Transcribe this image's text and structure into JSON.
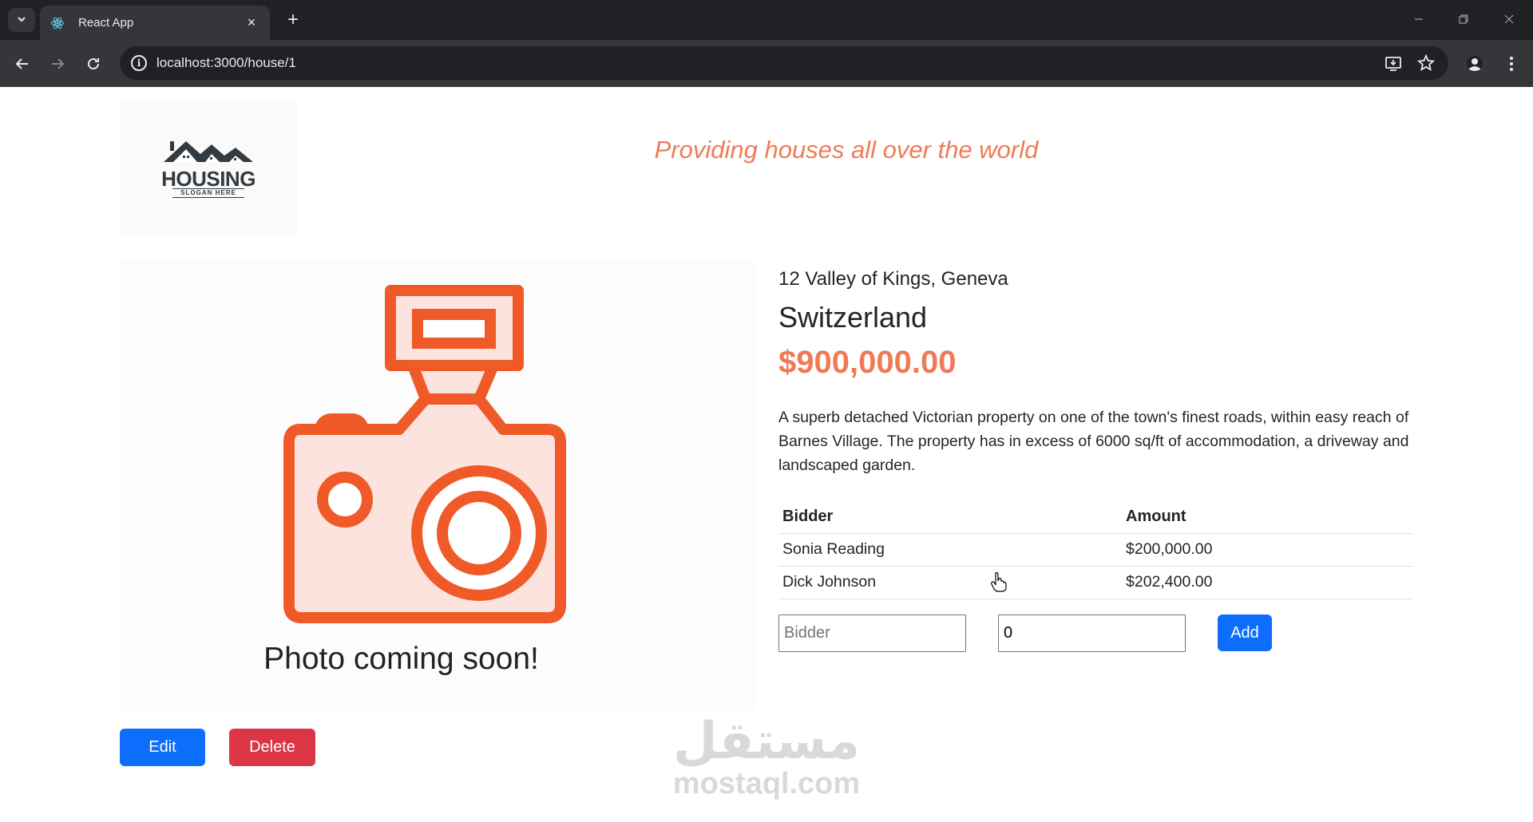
{
  "browser": {
    "tab_title": "React App",
    "new_tab_glyph": "+",
    "close_glyph": "×",
    "url": "localhost:3000/house/1"
  },
  "header": {
    "logo_text": "HOUSING",
    "logo_slogan": "SLOGAN HERE",
    "tagline": "Providing houses all over the world"
  },
  "photo": {
    "caption": "Photo coming soon!",
    "icon": "camera-icon",
    "accent_color": "#f05a28",
    "fill_color": "#fde3dd"
  },
  "house": {
    "address": "12 Valley of Kings, Geneva",
    "country": "Switzerland",
    "price": "$900,000.00",
    "description": "A superb detached Victorian property on one of the town's finest roads, within easy reach of Barnes Village. The property has in excess of 6000 sq/ft of accommodation, a driveway and landscaped garden."
  },
  "bids": {
    "headers": {
      "bidder": "Bidder",
      "amount": "Amount"
    },
    "rows": [
      {
        "bidder": "Sonia Reading",
        "amount": "$200,000.00"
      },
      {
        "bidder": "Dick Johnson",
        "amount": "$202,400.00"
      }
    ]
  },
  "bid_form": {
    "bidder_placeholder": "Bidder",
    "amount_value": "0",
    "add_label": "Add"
  },
  "actions": {
    "edit_label": "Edit",
    "delete_label": "Delete"
  },
  "watermark": {
    "arabic": "مستقل",
    "latin": "mostaql.com"
  },
  "colors": {
    "primary": "#0d6efd",
    "danger": "#dc3545",
    "accent": "#f07a55"
  }
}
